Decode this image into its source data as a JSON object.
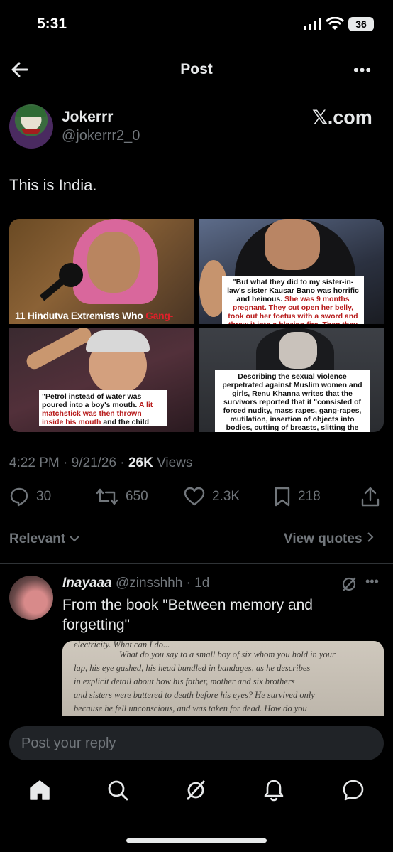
{
  "status_bar": {
    "time": "5:31",
    "battery": "36"
  },
  "header": {
    "title": "Post"
  },
  "author": {
    "name": "Jokerrr",
    "handle": "@jokerrr2_0",
    "source": "𝕏.com"
  },
  "post": {
    "text": "This is India.",
    "media": {
      "c1_caption": "11 Hindutva Extremists Who ",
      "c1_caption_red": "Gang-",
      "c2_quote": "\"But what they did to my sister-in-law's sister Kausar Bano was horrific and heinous. ",
      "c2_quote_red": "She was 9 months pregnant. They cut open her belly, took out her foetus with a sword and threw it into a blazing fire. Then they burnt her as well.\"",
      "c3_quote": "\"Petrol instead of water was poured into a boy's mouth. ",
      "c3_quote_red": "A lit matchstick was then thrown inside his mouth",
      "c3_quote_end": " and the child just blasted apart.\"",
      "c4_quote": "Describing the sexual violence perpetrated against Muslim women and girls, Renu Khanna writes that the survivors reported that it \"consisted of forced nudity, mass rapes, gang-rapes, mutilation, insertion of objects into bodies, cutting of breasts, slitting the stomach and reproductive organs, and carving of Hindu religious"
    },
    "time": "4:22 PM",
    "date": "9/21/26",
    "views_count": "26K",
    "views_label": "Views",
    "replies": "30",
    "reposts": "650",
    "likes": "2.3K",
    "bookmarks": "218"
  },
  "sort": {
    "label": "Relevant",
    "view_quotes": "View quotes"
  },
  "reply": {
    "name": "Inayaaa",
    "handle": "@zinsshhh",
    "age": "· 1d",
    "text": "From the book \"Between memory and forgetting\"",
    "book_lines": [
      "electricity. What can I do...",
      "What do you say to a small boy of six whom you hold in your",
      "lap, his eye gashed, his head bundled in bandages, as he describes",
      "in explicit detail about how his father, mother and six brothers",
      "and sisters were battered to death before his eyes? He survived only",
      "because he fell unconscious, and was taken for dead. How do you"
    ]
  },
  "composer": {
    "placeholder": "Post your reply"
  }
}
